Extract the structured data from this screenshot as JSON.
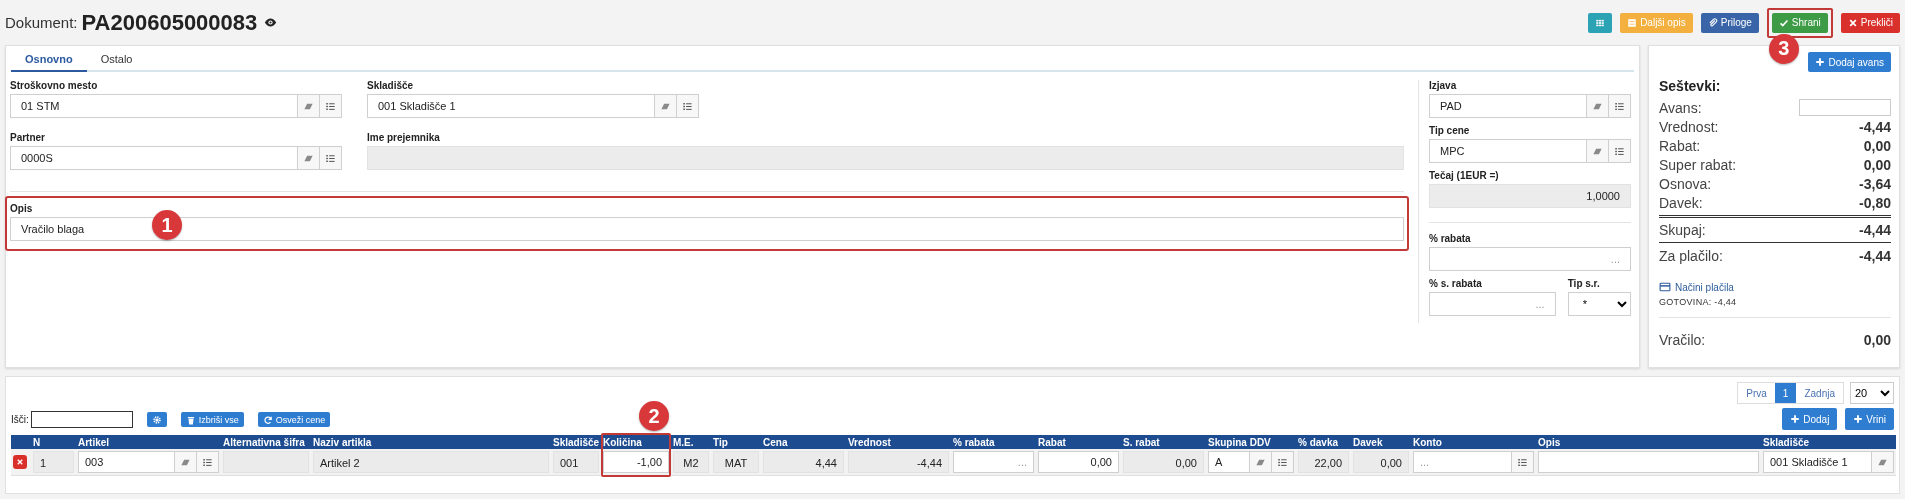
{
  "header": {
    "label": "Dokument:",
    "number": "PA200605000083"
  },
  "toolbar": [
    {
      "kind": "info"
    },
    {
      "kind": "warning",
      "label": "Daljši opis"
    },
    {
      "kind": "primary",
      "label": "Priloge"
    },
    {
      "kind": "success",
      "label": "Shrani",
      "annotation": "3"
    },
    {
      "kind": "danger",
      "label": "Prekliči"
    }
  ],
  "tabs": [
    {
      "label": "Osnovno",
      "selected": true
    },
    {
      "label": "Ostalo",
      "selected": false
    }
  ],
  "form": {
    "rows": [
      [
        {
          "label": "Stroškovno mesto",
          "kind": "lookup",
          "value": "01 STM"
        },
        {
          "label": "Skladišče",
          "kind": "lookup",
          "value": "001 Skladišče 1"
        }
      ],
      [
        {
          "label": "Partner",
          "kind": "lookup",
          "value": "0000S"
        },
        {
          "label": "Ime prejemnika",
          "kind": "readonly"
        }
      ]
    ],
    "description": {
      "label": "Opis",
      "kind": "text",
      "value": "Vračilo blaga",
      "annotation": "1"
    },
    "side_fields": [
      {
        "label": "Izjava",
        "kind": "lookup",
        "value": "PAD"
      },
      {
        "label": "Tip cene",
        "kind": "lookup",
        "value": "MPC"
      },
      {
        "label": "Tečaj (1EUR =)",
        "kind": "readonly_number",
        "value": "1,0000"
      }
    ],
    "discount": {
      "label": "% rabata",
      "kind": "number",
      "placeholder": "..."
    },
    "pair": [
      {
        "label": "% s. rabata",
        "kind": "number",
        "placeholder": "..."
      },
      {
        "label": "Tip s.r.",
        "kind": "select",
        "value": "*"
      }
    ]
  },
  "summary": {
    "add_button": "Dodaj avans",
    "title": "Seštevki:",
    "advance_label": "Avans:",
    "lines": [
      {
        "label": "Vrednost:",
        "value": "-4,44"
      },
      {
        "label": "Rabat:",
        "value": "0,00"
      },
      {
        "label": "Super rabat:",
        "value": "0,00"
      },
      {
        "label": "Osnova:",
        "value": "-3,64"
      },
      {
        "label": "Davek:",
        "value": "-0,80"
      }
    ],
    "totals": [
      {
        "label": "Skupaj:",
        "value": "-4,44"
      },
      {
        "label": "Za plačilo:",
        "value": "-4,44"
      }
    ],
    "payment_link": "Načini plačila",
    "payment": "GOTOVINA: -4,44",
    "change": {
      "label": "Vračilo:",
      "value": "0,00"
    }
  },
  "grid": {
    "pager": [
      {
        "label": "Prva",
        "selected": false
      },
      {
        "label": "1",
        "selected": true
      },
      {
        "label": "Zadnja",
        "selected": false
      }
    ],
    "page_size": "20",
    "search_label": "Išči:",
    "actions": [
      "Izbriši vse",
      "Osveži cene"
    ],
    "add_buttons": [
      "Dodaj",
      "Vrini"
    ],
    "columns": [
      {
        "label": "N"
      },
      {
        "label": "Artikel"
      },
      {
        "label": "Alternativna šifra"
      },
      {
        "label": "Naziv artikla"
      },
      {
        "label": "Skladišče"
      },
      {
        "label": "Količina",
        "annotation": "2"
      },
      {
        "label": "M.E."
      },
      {
        "label": "Tip"
      },
      {
        "label": "Cena"
      },
      {
        "label": "Vrednost"
      },
      {
        "label": "% rabata"
      },
      {
        "label": "Rabat"
      },
      {
        "label": "S. rabat"
      },
      {
        "label": "Skupina DDV"
      },
      {
        "label": "% davka"
      },
      {
        "label": "Davek"
      },
      {
        "label": "Konto"
      },
      {
        "label": "Opis"
      },
      {
        "label": "Skladišče"
      }
    ],
    "rows": [
      {
        "cells": [
          {
            "kind": "plain",
            "value": "1"
          },
          {
            "kind": "lookup",
            "value": "003"
          },
          {
            "kind": "plain"
          },
          {
            "kind": "plain",
            "value": "Artikel 2"
          },
          {
            "kind": "plain",
            "value": "001"
          },
          {
            "kind": "number",
            "value": "-1,00"
          },
          {
            "kind": "plain",
            "value": "M2"
          },
          {
            "kind": "plain",
            "value": "MAT"
          },
          {
            "kind": "plain",
            "value": "4,44"
          },
          {
            "kind": "plain",
            "value": "-4,44"
          },
          {
            "kind": "number",
            "placeholder": "..."
          },
          {
            "kind": "number",
            "value": "0,00"
          },
          {
            "kind": "plain",
            "value": "0,00"
          },
          {
            "kind": "lookup",
            "value": "A"
          },
          {
            "kind": "plain",
            "value": "22,00"
          },
          {
            "kind": "plain",
            "value": "0,00"
          },
          {
            "kind": "lookup_list",
            "placeholder": "..."
          },
          {
            "kind": "text"
          },
          {
            "kind": "lookup_erase",
            "value": "001 Skladišče 1"
          }
        ]
      }
    ]
  }
}
